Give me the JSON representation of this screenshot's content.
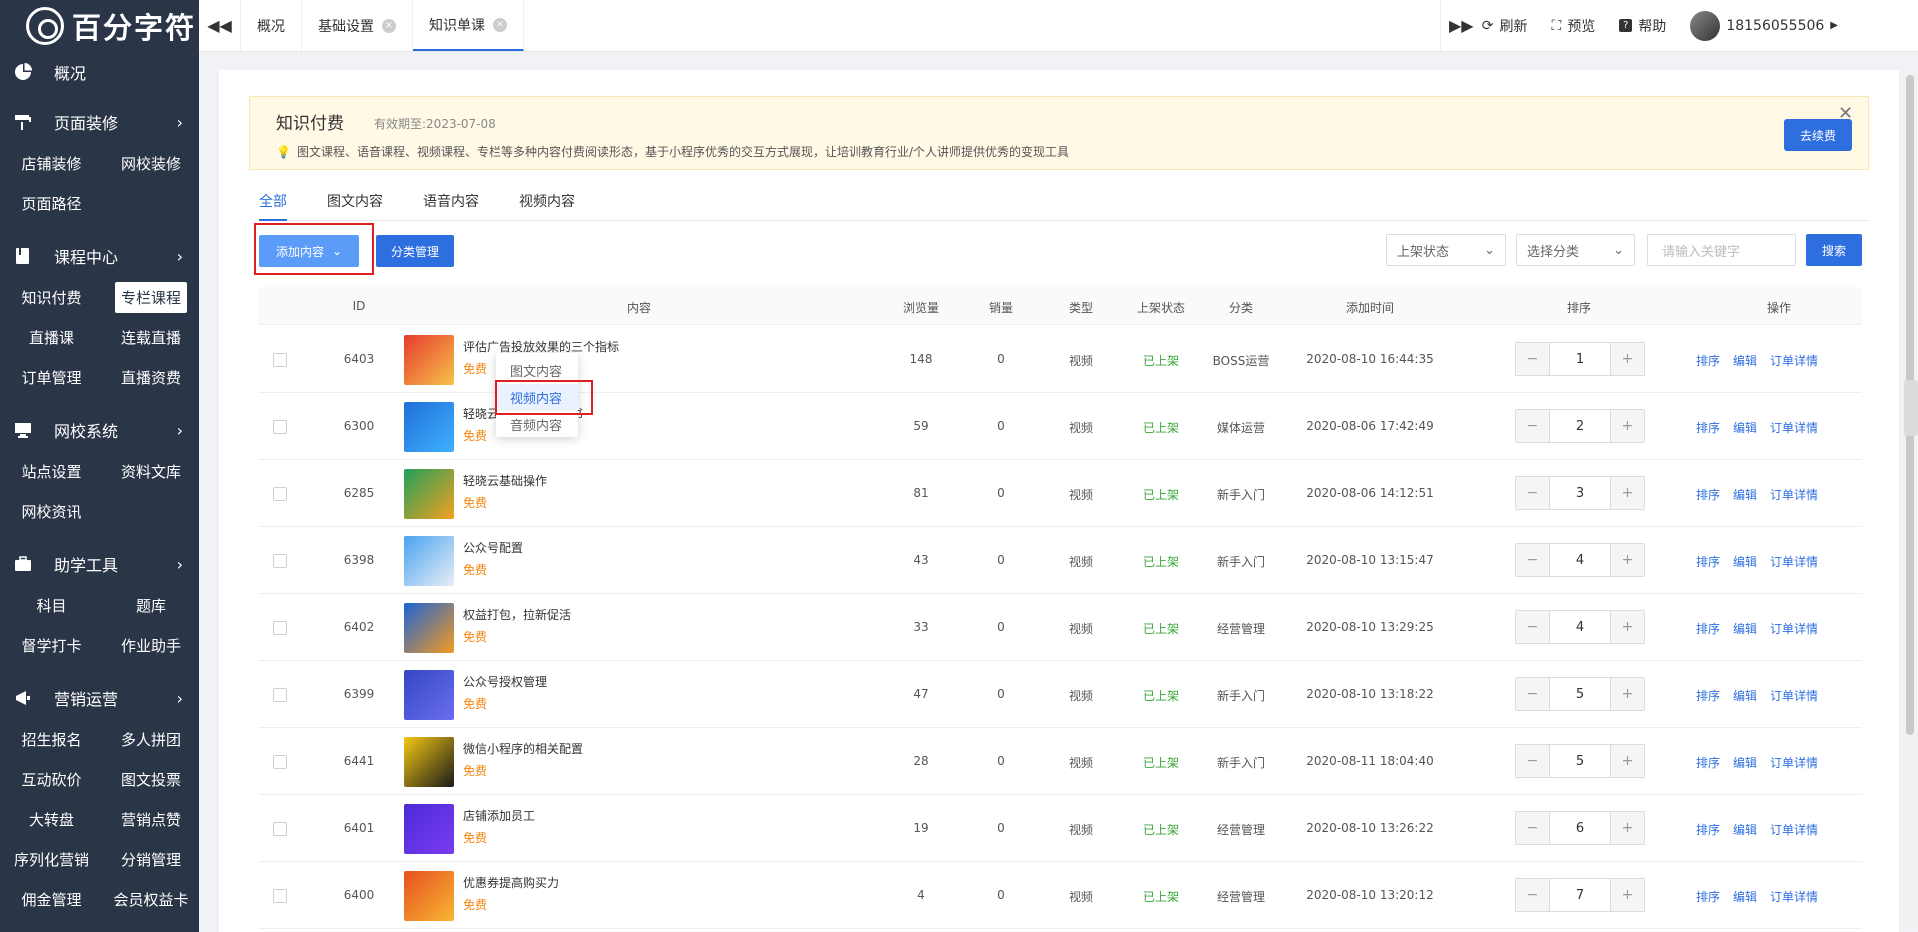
{
  "brand": {
    "logo_text": "百分字符"
  },
  "sidebar": {
    "overview": "概况",
    "groups": [
      {
        "label": "页面装修",
        "items": [
          "店铺装修",
          "网校装修",
          "页面路径"
        ]
      },
      {
        "label": "课程中心",
        "items": [
          "知识付费",
          "专栏课程",
          "直播课",
          "连载直播",
          "订单管理",
          "直播资费"
        ]
      },
      {
        "label": "网校系统",
        "items": [
          "站点设置",
          "资料文库",
          "网校资讯"
        ]
      },
      {
        "label": "助学工具",
        "items": [
          "科目",
          "题库",
          "督学打卡",
          "作业助手"
        ]
      },
      {
        "label": "营销运营",
        "items": [
          "招生报名",
          "多人拼团",
          "互动砍价",
          "图文投票",
          "大转盘",
          "营销点赞",
          "序列化营销",
          "分销管理",
          "佣金管理",
          "会员权益卡"
        ]
      }
    ],
    "active_item": "专栏课程"
  },
  "topbar": {
    "tabs": [
      {
        "label": "概况",
        "closable": false
      },
      {
        "label": "基础设置",
        "closable": true
      },
      {
        "label": "知识单课",
        "closable": true,
        "active": true
      }
    ],
    "refresh": "刷新",
    "preview": "预览",
    "help": "帮助",
    "user": "18156055506"
  },
  "banner": {
    "title": "知识付费",
    "expiry": "有效期至:2023-07-08",
    "desc": "图文课程、语音课程、视频课程、专栏等多种内容付费阅读形态，基于小程序优秀的交互方式展现，让培训教育行业/个人讲师提供优秀的变现工具",
    "renew_btn": "去续费"
  },
  "content_tabs": [
    "全部",
    "图文内容",
    "语音内容",
    "视频内容"
  ],
  "toolbar": {
    "add_btn": "添加内容",
    "category_btn": "分类管理",
    "status_select": "上架状态",
    "category_select": "选择分类",
    "search_placeholder": "请输入关键字",
    "search_btn": "搜索"
  },
  "dropdown": {
    "items": [
      "图文内容",
      "视频内容",
      "音频内容"
    ],
    "hover_index": 1
  },
  "table": {
    "headers": {
      "id": "ID",
      "content": "内容",
      "views": "浏览量",
      "sales": "销量",
      "type": "类型",
      "status": "上架状态",
      "category": "分类",
      "time": "添加时间",
      "sort": "排序",
      "ops": "操作"
    },
    "rows": [
      {
        "id": "6403",
        "title": "评估广告投放效果的三个指标",
        "price": "免费",
        "views": "148",
        "sales": "0",
        "type": "视频",
        "status": "已上架",
        "category": "BOSS运营",
        "time": "2020-08-10 16:44:35",
        "sort": "1"
      },
      {
        "id": "6300",
        "title": "轻晓云教育运营白皮书",
        "price": "免费",
        "views": "59",
        "sales": "0",
        "type": "视频",
        "status": "已上架",
        "category": "媒体运营",
        "time": "2020-08-06 17:42:49",
        "sort": "2"
      },
      {
        "id": "6285",
        "title": "轻晓云基础操作",
        "price": "免费",
        "views": "81",
        "sales": "0",
        "type": "视频",
        "status": "已上架",
        "category": "新手入门",
        "time": "2020-08-06 14:12:51",
        "sort": "3"
      },
      {
        "id": "6398",
        "title": "公众号配置",
        "price": "免费",
        "views": "43",
        "sales": "0",
        "type": "视频",
        "status": "已上架",
        "category": "新手入门",
        "time": "2020-08-10 13:15:47",
        "sort": "4"
      },
      {
        "id": "6402",
        "title": "权益打包，拉新促活",
        "price": "免费",
        "views": "33",
        "sales": "0",
        "type": "视频",
        "status": "已上架",
        "category": "经营管理",
        "time": "2020-08-10 13:29:25",
        "sort": "4"
      },
      {
        "id": "6399",
        "title": "公众号授权管理",
        "price": "免费",
        "views": "47",
        "sales": "0",
        "type": "视频",
        "status": "已上架",
        "category": "新手入门",
        "time": "2020-08-10 13:18:22",
        "sort": "5"
      },
      {
        "id": "6441",
        "title": "微信小程序的相关配置",
        "price": "免费",
        "views": "28",
        "sales": "0",
        "type": "视频",
        "status": "已上架",
        "category": "新手入门",
        "time": "2020-08-11 18:04:40",
        "sort": "5"
      },
      {
        "id": "6401",
        "title": "店铺添加员工",
        "price": "免费",
        "views": "19",
        "sales": "0",
        "type": "视频",
        "status": "已上架",
        "category": "经营管理",
        "time": "2020-08-10 13:26:22",
        "sort": "6"
      },
      {
        "id": "6400",
        "title": "优惠券提高购买力",
        "price": "免费",
        "views": "4",
        "sales": "0",
        "type": "视频",
        "status": "已上架",
        "category": "经营管理",
        "time": "2020-08-10 13:20:12",
        "sort": "7"
      }
    ],
    "op_labels": [
      "排序",
      "编辑",
      "订单详情"
    ]
  },
  "colors": {
    "sidebar": "#2b3548",
    "primary": "#2e6fe0",
    "highlight": "#e02020",
    "status_green": "#3aa63a",
    "free_orange": "#f5860f"
  }
}
